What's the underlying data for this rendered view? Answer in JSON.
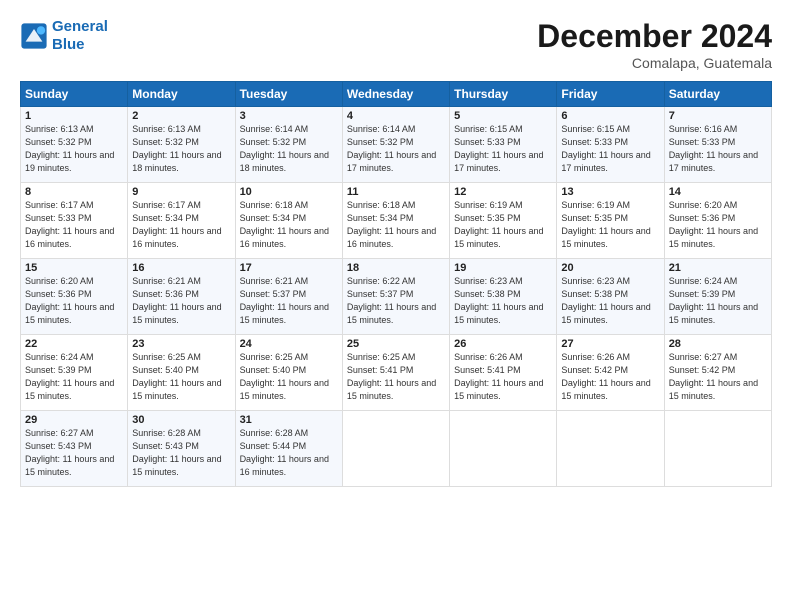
{
  "header": {
    "logo_line1": "General",
    "logo_line2": "Blue",
    "month_title": "December 2024",
    "location": "Comalapa, Guatemala"
  },
  "days_of_week": [
    "Sunday",
    "Monday",
    "Tuesday",
    "Wednesday",
    "Thursday",
    "Friday",
    "Saturday"
  ],
  "weeks": [
    [
      {
        "day": "1",
        "sunrise": "6:13 AM",
        "sunset": "5:32 PM",
        "daylight": "11 hours and 19 minutes."
      },
      {
        "day": "2",
        "sunrise": "6:13 AM",
        "sunset": "5:32 PM",
        "daylight": "11 hours and 18 minutes."
      },
      {
        "day": "3",
        "sunrise": "6:14 AM",
        "sunset": "5:32 PM",
        "daylight": "11 hours and 18 minutes."
      },
      {
        "day": "4",
        "sunrise": "6:14 AM",
        "sunset": "5:32 PM",
        "daylight": "11 hours and 17 minutes."
      },
      {
        "day": "5",
        "sunrise": "6:15 AM",
        "sunset": "5:33 PM",
        "daylight": "11 hours and 17 minutes."
      },
      {
        "day": "6",
        "sunrise": "6:15 AM",
        "sunset": "5:33 PM",
        "daylight": "11 hours and 17 minutes."
      },
      {
        "day": "7",
        "sunrise": "6:16 AM",
        "sunset": "5:33 PM",
        "daylight": "11 hours and 17 minutes."
      }
    ],
    [
      {
        "day": "8",
        "sunrise": "6:17 AM",
        "sunset": "5:33 PM",
        "daylight": "11 hours and 16 minutes."
      },
      {
        "day": "9",
        "sunrise": "6:17 AM",
        "sunset": "5:34 PM",
        "daylight": "11 hours and 16 minutes."
      },
      {
        "day": "10",
        "sunrise": "6:18 AM",
        "sunset": "5:34 PM",
        "daylight": "11 hours and 16 minutes."
      },
      {
        "day": "11",
        "sunrise": "6:18 AM",
        "sunset": "5:34 PM",
        "daylight": "11 hours and 16 minutes."
      },
      {
        "day": "12",
        "sunrise": "6:19 AM",
        "sunset": "5:35 PM",
        "daylight": "11 hours and 15 minutes."
      },
      {
        "day": "13",
        "sunrise": "6:19 AM",
        "sunset": "5:35 PM",
        "daylight": "11 hours and 15 minutes."
      },
      {
        "day": "14",
        "sunrise": "6:20 AM",
        "sunset": "5:36 PM",
        "daylight": "11 hours and 15 minutes."
      }
    ],
    [
      {
        "day": "15",
        "sunrise": "6:20 AM",
        "sunset": "5:36 PM",
        "daylight": "11 hours and 15 minutes."
      },
      {
        "day": "16",
        "sunrise": "6:21 AM",
        "sunset": "5:36 PM",
        "daylight": "11 hours and 15 minutes."
      },
      {
        "day": "17",
        "sunrise": "6:21 AM",
        "sunset": "5:37 PM",
        "daylight": "11 hours and 15 minutes."
      },
      {
        "day": "18",
        "sunrise": "6:22 AM",
        "sunset": "5:37 PM",
        "daylight": "11 hours and 15 minutes."
      },
      {
        "day": "19",
        "sunrise": "6:23 AM",
        "sunset": "5:38 PM",
        "daylight": "11 hours and 15 minutes."
      },
      {
        "day": "20",
        "sunrise": "6:23 AM",
        "sunset": "5:38 PM",
        "daylight": "11 hours and 15 minutes."
      },
      {
        "day": "21",
        "sunrise": "6:24 AM",
        "sunset": "5:39 PM",
        "daylight": "11 hours and 15 minutes."
      }
    ],
    [
      {
        "day": "22",
        "sunrise": "6:24 AM",
        "sunset": "5:39 PM",
        "daylight": "11 hours and 15 minutes."
      },
      {
        "day": "23",
        "sunrise": "6:25 AM",
        "sunset": "5:40 PM",
        "daylight": "11 hours and 15 minutes."
      },
      {
        "day": "24",
        "sunrise": "6:25 AM",
        "sunset": "5:40 PM",
        "daylight": "11 hours and 15 minutes."
      },
      {
        "day": "25",
        "sunrise": "6:25 AM",
        "sunset": "5:41 PM",
        "daylight": "11 hours and 15 minutes."
      },
      {
        "day": "26",
        "sunrise": "6:26 AM",
        "sunset": "5:41 PM",
        "daylight": "11 hours and 15 minutes."
      },
      {
        "day": "27",
        "sunrise": "6:26 AM",
        "sunset": "5:42 PM",
        "daylight": "11 hours and 15 minutes."
      },
      {
        "day": "28",
        "sunrise": "6:27 AM",
        "sunset": "5:42 PM",
        "daylight": "11 hours and 15 minutes."
      }
    ],
    [
      {
        "day": "29",
        "sunrise": "6:27 AM",
        "sunset": "5:43 PM",
        "daylight": "11 hours and 15 minutes."
      },
      {
        "day": "30",
        "sunrise": "6:28 AM",
        "sunset": "5:43 PM",
        "daylight": "11 hours and 15 minutes."
      },
      {
        "day": "31",
        "sunrise": "6:28 AM",
        "sunset": "5:44 PM",
        "daylight": "11 hours and 16 minutes."
      },
      null,
      null,
      null,
      null
    ]
  ],
  "labels": {
    "sunrise": "Sunrise:",
    "sunset": "Sunset:",
    "daylight": "Daylight:"
  }
}
